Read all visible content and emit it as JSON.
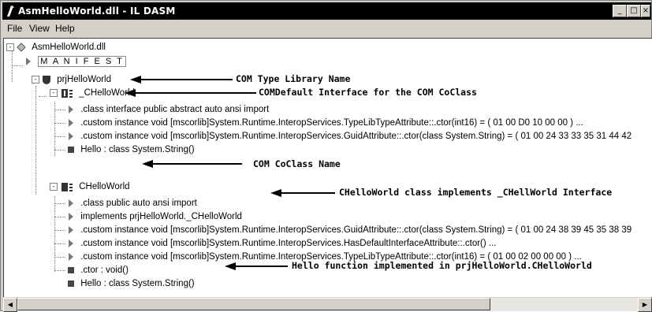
{
  "window": {
    "title": "AsmHelloWorld.dll - IL DASM"
  },
  "titlebar_buttons": {
    "minimize": "_",
    "maximize": "□",
    "close": "×"
  },
  "menu": [
    "File",
    "View",
    "Help"
  ],
  "tree": {
    "root": "AsmHelloWorld.dll",
    "manifest": "M A N I F E S T",
    "namespace": "prjHelloWorld",
    "interface": {
      "name": "_CHelloWorld",
      "children": [
        ".class interface public abstract auto ansi import",
        ".custom instance void [mscorlib]System.Runtime.InteropServices.TypeLibTypeAttribute::.ctor(int16) = ( 01 00 D0 10 00 00 ) ...",
        ".custom instance void [mscorlib]System.Runtime.InteropServices.GuidAttribute::.ctor(class System.String) = ( 01 00 24 33 33 35 31 44 42",
        "Hello : class System.String()"
      ]
    },
    "class": {
      "name": "CHelloWorld",
      "children": [
        ".class public auto ansi import",
        "implements prjHelloWorld._CHelloWorld",
        ".custom instance void [mscorlib]System.Runtime.InteropServices.GuidAttribute::.ctor(class System.String) = ( 01 00 24 38 39 45 35 38 39",
        ".custom instance void [mscorlib]System.Runtime.InteropServices.HasDefaultInterfaceAttribute::.ctor() ...",
        ".custom instance void [mscorlib]System.Runtime.InteropServices.TypeLibTypeAttribute::.ctor(int16) = ( 01 00 02 00 00 00 ) ...",
        ".ctor : void()",
        "Hello : class System.String()"
      ]
    }
  },
  "annotations": {
    "type_library": "COM Type Library Name",
    "default_interface": "COMDefault Interface for the COM CoClass",
    "coclass": "COM CoClass Name",
    "implements": "CHelloWorld class implements _CHellWorld Interface",
    "hello_function": "Hello function implemented in prjHelloWorld.CHelloWorld"
  },
  "colors": {
    "titlebar": "#000000",
    "chrome": "#d4d0c8",
    "tree_bg": "#ffffff"
  }
}
